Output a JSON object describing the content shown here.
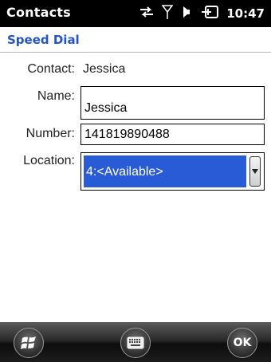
{
  "statusbar": {
    "app_title": "Contacts",
    "time": "10:47",
    "icons": [
      "data-transfer-icon",
      "signal-antenna-icon",
      "speaker-icon",
      "battery-charging-icon"
    ]
  },
  "header": {
    "title": "Speed Dial"
  },
  "form": {
    "contact_label": "Contact:",
    "contact_value": "Jessica",
    "name_label": "Name:",
    "name_value": "Jessica",
    "number_label": "Number:",
    "number_value": "141819890488",
    "location_label": "Location:",
    "location_value": "4:<Available>"
  },
  "softkeys": {
    "start": "windows-start-icon",
    "keyboard": "keyboard-icon",
    "ok_label": "OK"
  },
  "colors": {
    "accent": "#2255c9",
    "selection": "#2a5bd6"
  }
}
